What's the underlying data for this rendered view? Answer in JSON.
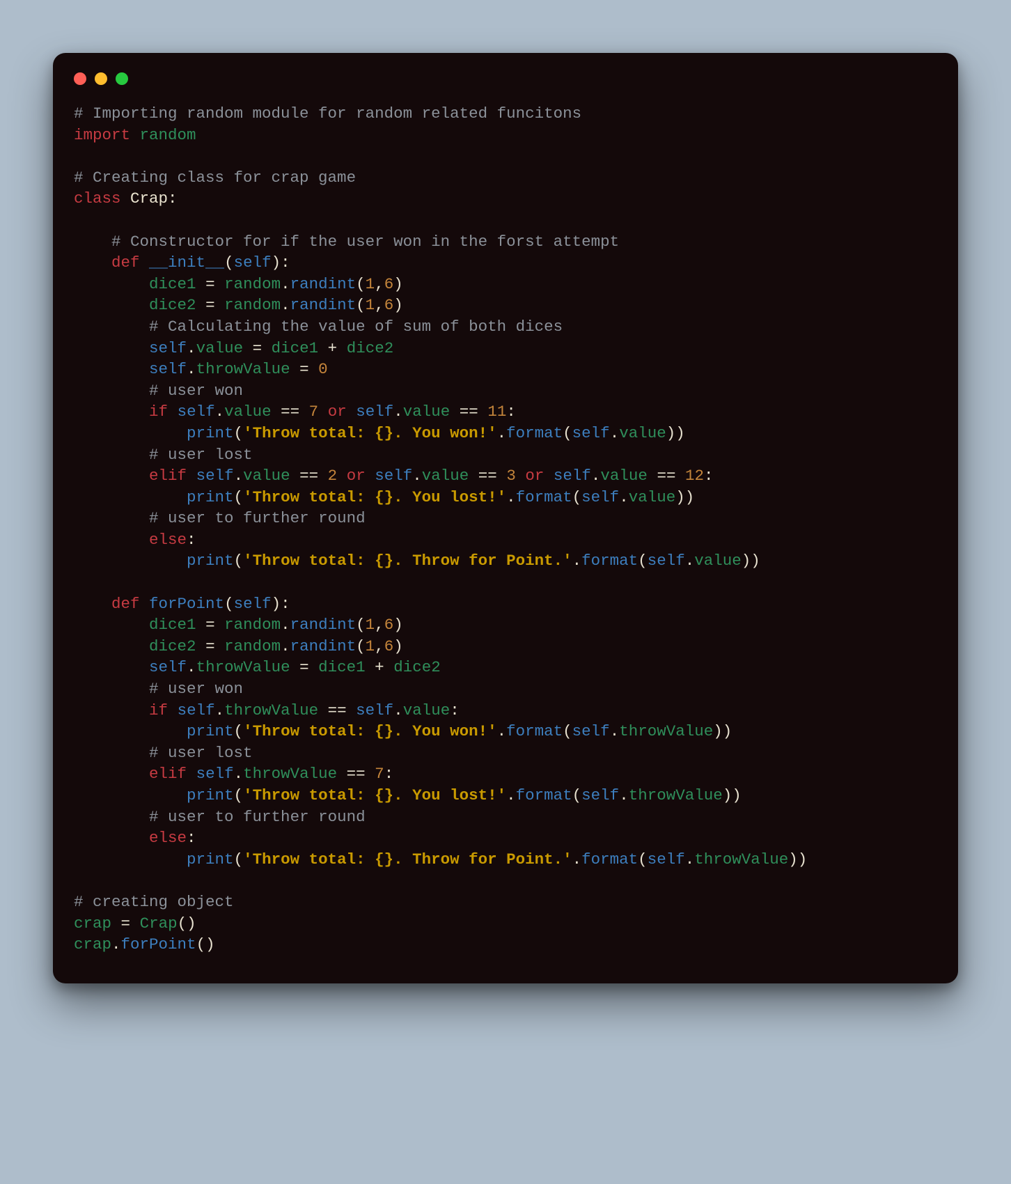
{
  "colors": {
    "background_page": "#aebdcb",
    "background_window": "#14090a",
    "traffic_red": "#ff5f56",
    "traffic_yellow": "#ffbd2e",
    "traffic_green": "#27c93f",
    "comment": "#8b9199",
    "keyword": "#c73b42",
    "module_green": "#2f8f5b",
    "function_blue": "#3d7fbf",
    "number_orange": "#c5853b",
    "string_gold": "#c99a00",
    "default_text": "#e8e2d0"
  },
  "code": {
    "language": "python",
    "lines": [
      "# Importing random module for random related funcitons",
      "import random",
      "",
      "# Creating class for crap game",
      "class Crap:",
      "",
      "    # Constructor for if the user won in the forst attempt",
      "    def __init__(self):",
      "        dice1 = random.randint(1,6)",
      "        dice2 = random.randint(1,6)",
      "        # Calculating the value of sum of both dices",
      "        self.value = dice1 + dice2",
      "        self.throwValue = 0",
      "        # user won",
      "        if self.value == 7 or self.value == 11:",
      "            print('Throw total: {}. You won!'.format(self.value))",
      "        # user lost",
      "        elif self.value == 2 or self.value == 3 or self.value == 12:",
      "            print('Throw total: {}. You lost!'.format(self.value))",
      "        # user to further round",
      "        else:",
      "            print('Throw total: {}. Throw for Point.'.format(self.value))",
      "",
      "    def forPoint(self):",
      "        dice1 = random.randint(1,6)",
      "        dice2 = random.randint(1,6)",
      "        self.throwValue = dice1 + dice2",
      "        # user won",
      "        if self.throwValue == self.value:",
      "            print('Throw total: {}. You won!'.format(self.throwValue))",
      "        # user lost",
      "        elif self.throwValue == 7:",
      "            print('Throw total: {}. You lost!'.format(self.throwValue))",
      "        # user to further round",
      "        else:",
      "            print('Throw total: {}. Throw for Point.'.format(self.throwValue))",
      "",
      "# creating object",
      "crap = Crap()",
      "crap.forPoint()"
    ]
  }
}
